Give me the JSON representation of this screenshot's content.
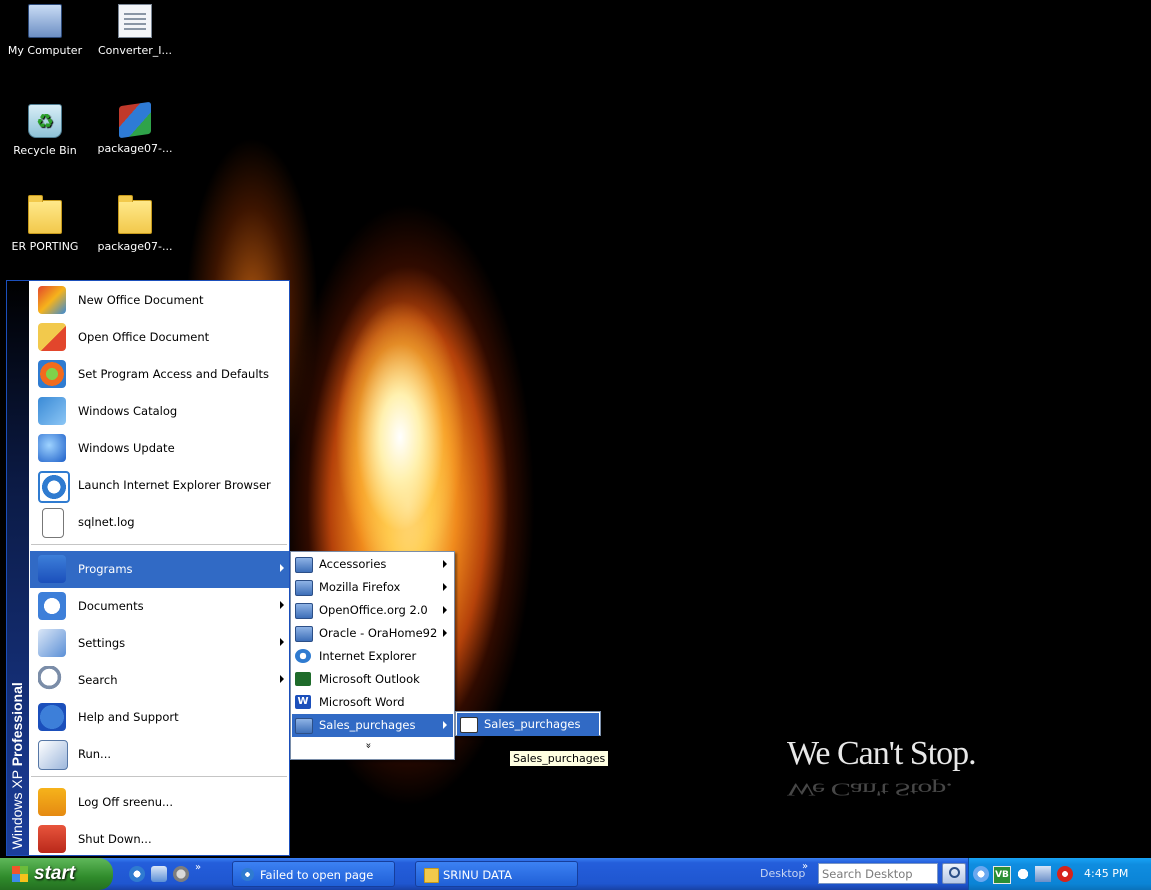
{
  "desktop": {
    "icons": [
      {
        "label": "My Computer",
        "icon": "computer-icon"
      },
      {
        "label": "Converter_I...",
        "icon": "document-icon"
      },
      {
        "label": "Recycle Bin",
        "icon": "recycle-bin-icon"
      },
      {
        "label": "package07-...",
        "icon": "winrar-archive-icon"
      },
      {
        "label": "ER PORTING",
        "icon": "folder-icon"
      },
      {
        "label": "package07-...",
        "icon": "folder-icon"
      }
    ],
    "wallpaper_slogan": "We Can't Stop."
  },
  "start_menu": {
    "band_text_1": "Windows XP",
    "band_text_2": "Professional",
    "items": [
      {
        "label": "New Office Document",
        "icon": "new-office-document-icon"
      },
      {
        "label": "Open Office Document",
        "icon": "open-office-document-icon"
      },
      {
        "label": "Set Program Access and Defaults",
        "icon": "program-access-icon"
      },
      {
        "label": "Windows Catalog",
        "icon": "windows-catalog-icon"
      },
      {
        "label": "Windows Update",
        "icon": "windows-update-icon"
      },
      {
        "label": "Launch Internet Explorer Browser",
        "icon": "internet-explorer-icon"
      },
      {
        "label": "sqlnet.log",
        "icon": "text-file-icon"
      },
      {
        "label": "Programs",
        "icon": "programs-icon",
        "submenu": true,
        "highlighted": true
      },
      {
        "label": "Documents",
        "icon": "documents-icon",
        "submenu": true
      },
      {
        "label": "Settings",
        "icon": "settings-icon",
        "submenu": true
      },
      {
        "label": "Search",
        "icon": "search-icon",
        "submenu": true
      },
      {
        "label": "Help and Support",
        "icon": "help-icon"
      },
      {
        "label": "Run...",
        "icon": "run-icon"
      },
      {
        "label": "Log Off sreenu...",
        "icon": "log-off-icon"
      },
      {
        "label": "Shut Down...",
        "icon": "shut-down-icon"
      }
    ]
  },
  "programs_submenu": {
    "items": [
      {
        "label": "Accessories",
        "icon": "program-group-icon",
        "submenu": true
      },
      {
        "label": "Mozilla Firefox",
        "icon": "program-group-icon",
        "submenu": true
      },
      {
        "label": "OpenOffice.org 2.0",
        "icon": "program-group-icon",
        "submenu": true
      },
      {
        "label": "Oracle - OraHome92",
        "icon": "program-group-icon",
        "submenu": true
      },
      {
        "label": "Internet Explorer",
        "icon": "internet-explorer-icon"
      },
      {
        "label": "Microsoft Outlook",
        "icon": "outlook-icon"
      },
      {
        "label": "Microsoft Word",
        "icon": "word-icon",
        "icon_text": "W"
      },
      {
        "label": "Sales_purchages",
        "icon": "program-group-icon",
        "submenu": true,
        "highlighted": true
      }
    ],
    "more_glyph": "»"
  },
  "sales_submenu": {
    "items": [
      {
        "label": "Sales_purchages",
        "icon": "shortcut-icon",
        "highlighted": true
      }
    ]
  },
  "tooltip": {
    "text": "Sales_purchages"
  },
  "taskbar": {
    "start_label": "start",
    "quick_launch_more": "»",
    "tasks": [
      {
        "label": "Failed to open page",
        "icon": "internet-explorer-icon"
      },
      {
        "label": "SRINU DATA",
        "icon": "folder-icon"
      }
    ],
    "desktop_toolbar_label": "Desktop",
    "desktop_toolbar_more": "»",
    "search_placeholder": "Search Desktop",
    "tray": {
      "vb_icon_text": "VB",
      "clock": "4:45 PM"
    }
  },
  "colors": {
    "menu_highlight": "#316ac5",
    "taskbar_blue": "#245edb",
    "start_button_green": "#2f8b2b",
    "tray_blue": "#0f8de0",
    "tooltip_bg": "#ffffe1"
  }
}
